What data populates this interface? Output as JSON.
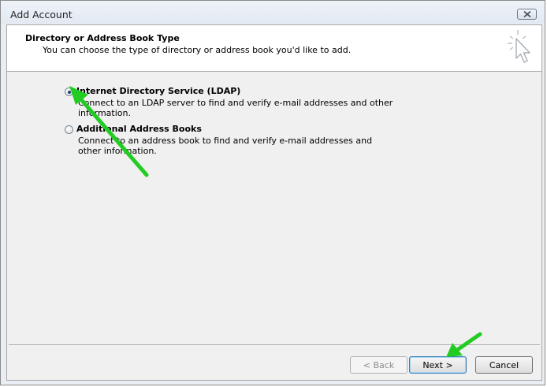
{
  "window": {
    "title": "Add Account"
  },
  "header": {
    "title": "Directory or Address Book Type",
    "subtitle": "You can choose the type of directory or address book you'd like to add."
  },
  "options": [
    {
      "label": "Internet Directory Service (LDAP)",
      "description": "Connect to an LDAP server to find and verify e-mail addresses and other information.",
      "selected": true
    },
    {
      "label": "Additional Address Books",
      "description": "Connect to an address book to find and verify e-mail addresses and other information.",
      "selected": false
    }
  ],
  "buttons": {
    "back": "< Back",
    "next": "Next >",
    "cancel": "Cancel"
  },
  "icons": {
    "close": "close-icon",
    "wizard": "wizard-cursor-icon"
  },
  "colors": {
    "annotation_arrow": "#22cc22",
    "window_frame": "#e9eef4"
  }
}
